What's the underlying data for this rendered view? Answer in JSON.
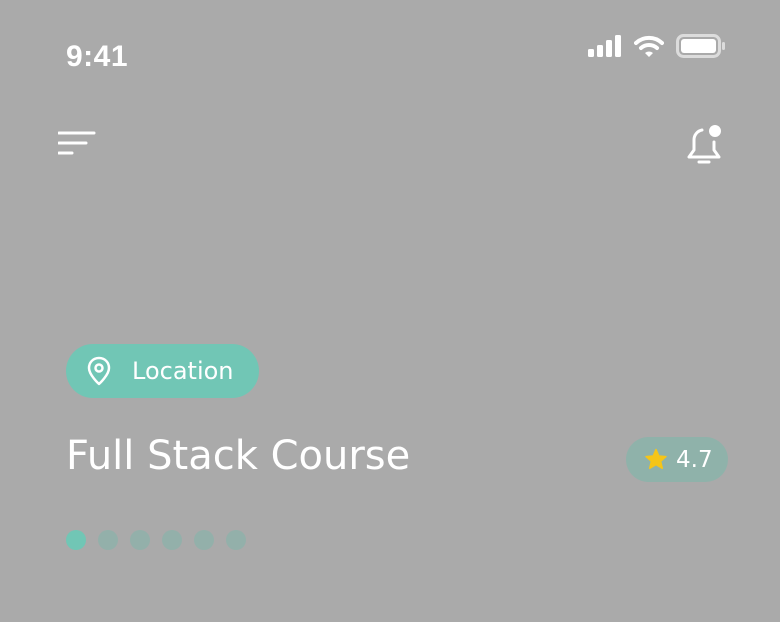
{
  "status_bar": {
    "time": "9:41"
  },
  "header": {
    "menu_icon": "menu-icon",
    "notification_icon": "bell-icon"
  },
  "location_chip": {
    "label": "Location",
    "icon": "location-pin-icon"
  },
  "course": {
    "title": "Full Stack Course",
    "rating": "4.7",
    "rating_icon": "star-icon"
  },
  "pager": {
    "total": 6,
    "active_index": 0
  },
  "colors": {
    "background": "#aaaaaa",
    "accent": "#71c6b5",
    "rating_badge": "#8fb2aa",
    "inactive_dot": "#93b0aa",
    "star": "#f5c518"
  }
}
